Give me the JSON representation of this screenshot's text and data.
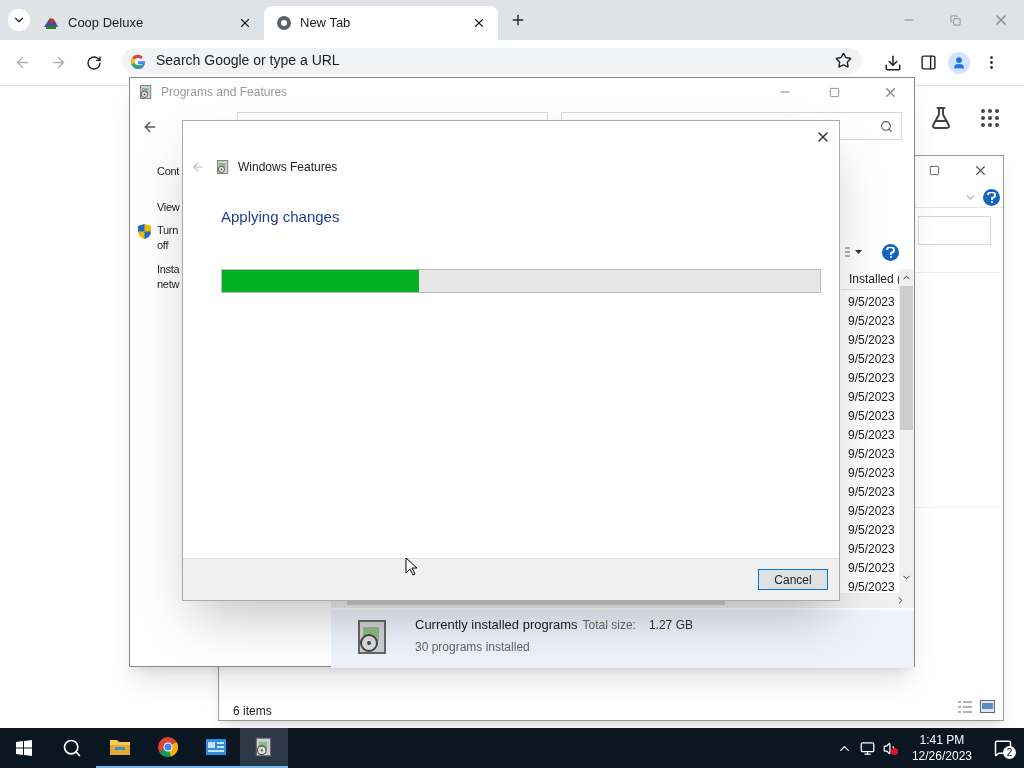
{
  "browser": {
    "tabs": [
      {
        "title": "Coop Deluxe",
        "selected": false
      },
      {
        "title": "New Tab",
        "selected": true
      }
    ],
    "address": {
      "placeholder": "Search Google or type a URL"
    }
  },
  "back_window": {
    "status": "6 items"
  },
  "programs_window": {
    "title": "Programs and Features",
    "left_pane": [
      "Cont",
      "View",
      "Turn\noff",
      "Insta\nnetw"
    ],
    "column_header": "Installed (",
    "dates": [
      "9/5/2023",
      "9/5/2023",
      "9/5/2023",
      "9/5/2023",
      "9/5/2023",
      "9/5/2023",
      "9/5/2023",
      "9/5/2023",
      "9/5/2023",
      "9/5/2023",
      "9/5/2023",
      "9/5/2023",
      "9/5/2023",
      "9/5/2023",
      "9/5/2023",
      "9/5/2023"
    ],
    "details": {
      "title": "Currently installed programs",
      "size_label": "Total size:",
      "size": "1.27 GB",
      "count": "30 programs installed"
    }
  },
  "dialog": {
    "title": "Windows Features",
    "heading": "Applying changes",
    "progress": {
      "level": 0.33
    },
    "button": "Cancel"
  },
  "taskbar": {
    "time": "1:41 PM",
    "date": "12/26/2023",
    "notifications": "2"
  }
}
